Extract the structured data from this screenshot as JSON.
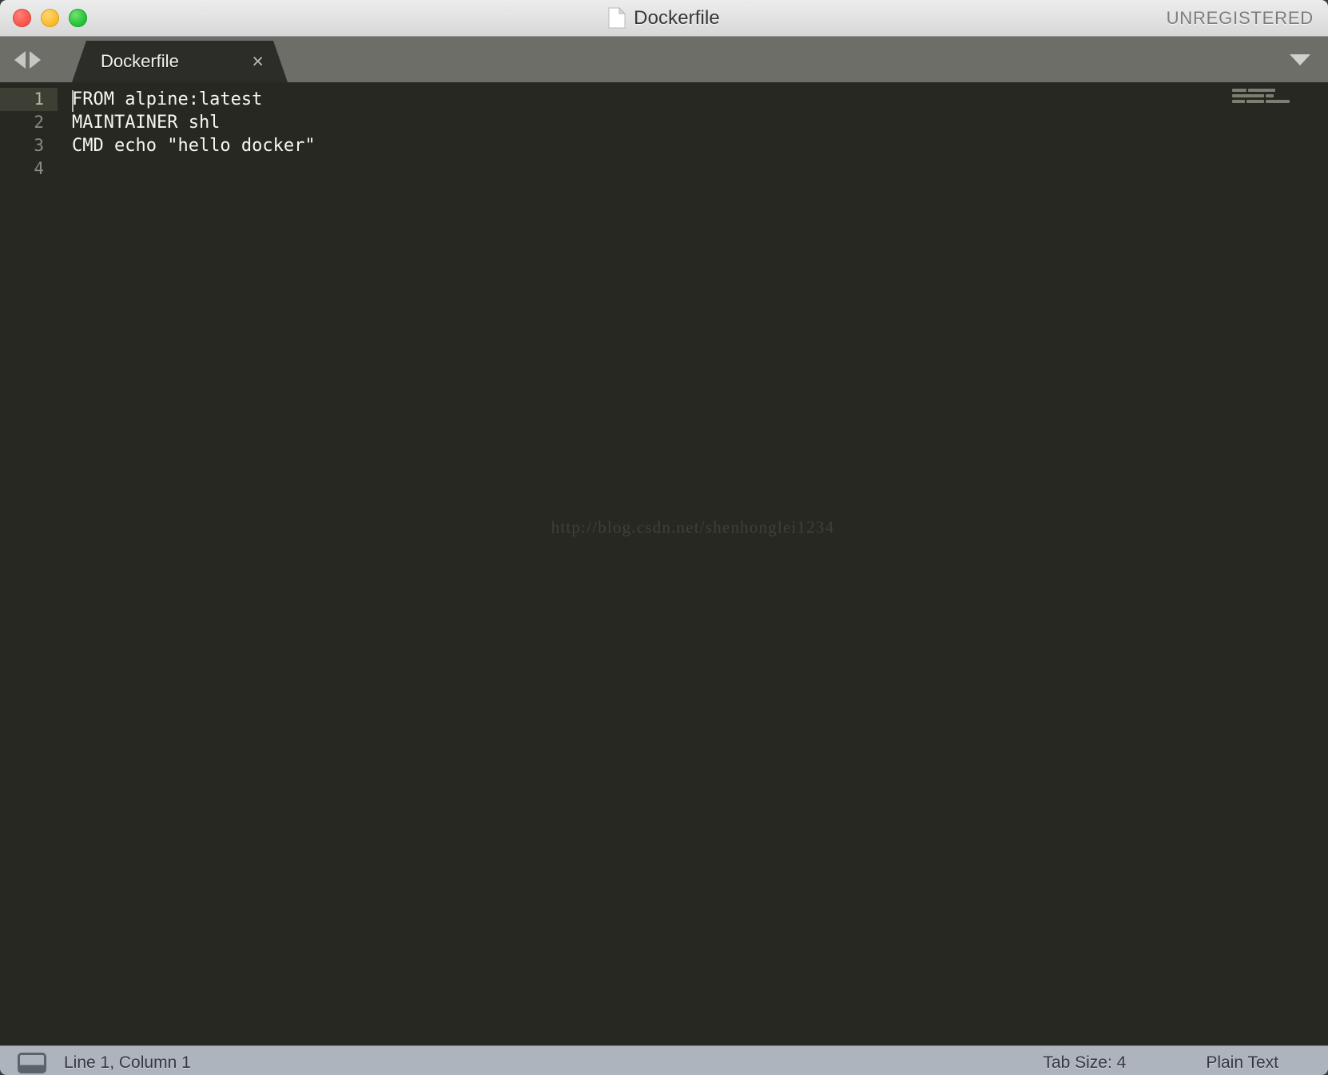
{
  "window": {
    "title": "Dockerfile",
    "title_icon": "document-icon",
    "license_badge": "UNREGISTERED",
    "traffic_lights": [
      {
        "name": "close",
        "color": "#f9594f"
      },
      {
        "name": "minimize",
        "color": "#fcbd2f"
      },
      {
        "name": "maximize",
        "color": "#28c63e"
      }
    ]
  },
  "tabbar": {
    "nav_back_icon": "triangle-left-icon",
    "nav_forward_icon": "triangle-right-icon",
    "menu_icon": "chevron-down-icon",
    "tabs": [
      {
        "label": "Dockerfile",
        "close_glyph": "×",
        "active": true
      }
    ]
  },
  "editor": {
    "background": "#272822",
    "active_line_background": "#3e3f34",
    "gutter_line_numbers": [
      "1",
      "2",
      "3",
      "4"
    ],
    "lines": [
      "FROM alpine:latest",
      "MAINTAINER shl",
      "CMD echo \"hello docker\"",
      ""
    ],
    "cursor_line": 1,
    "watermark": "http://blog.csdn.net/shenhonglei1234",
    "minimap": {
      "icon": "minimap-preview",
      "line_widths": [
        [
          18,
          34
        ],
        [
          40,
          10
        ],
        [
          16,
          22,
          30
        ]
      ]
    }
  },
  "statusbar": {
    "panel_toggle_icon": "console-panel-icon",
    "position": "Line 1, Column 1",
    "tab_size": "Tab Size: 4",
    "syntax": "Plain Text"
  }
}
